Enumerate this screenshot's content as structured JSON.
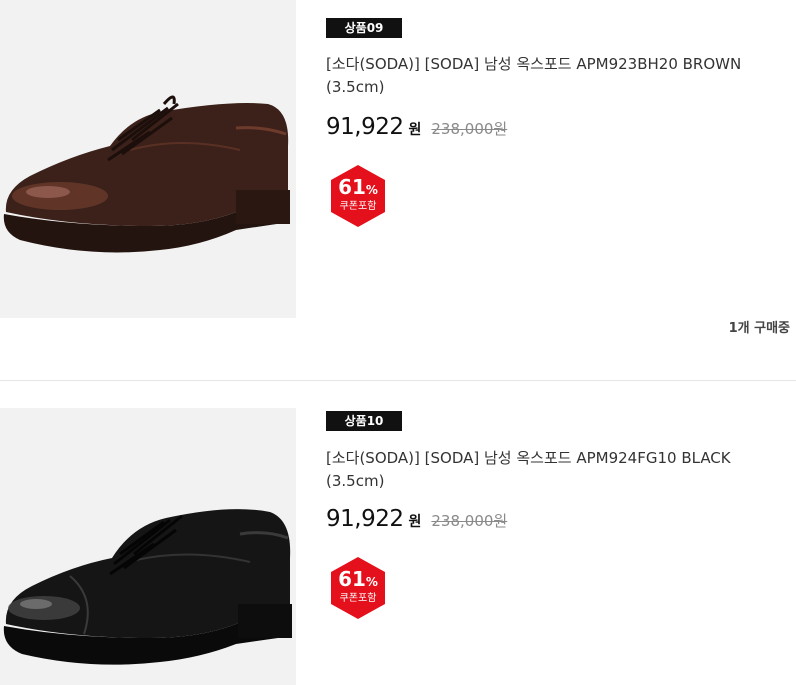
{
  "products": [
    {
      "badge": "상품09",
      "title": "[소다(SODA)] [SODA] 남성 옥스포드 APM923BH20 BROWN (3.5cm)",
      "price": "91,922",
      "price_unit": "원",
      "original_price": "238,000원",
      "discount_percent": "61",
      "discount_symbol": "%",
      "discount_note": "쿠폰포함",
      "purchase_count": "1개 구매중",
      "shoe_color": "#3b2119"
    },
    {
      "badge": "상품10",
      "title": "[소다(SODA)] [SODA] 남성 옥스포드 APM924FG10 BLACK (3.5cm)",
      "price": "91,922",
      "price_unit": "원",
      "original_price": "238,000원",
      "discount_percent": "61",
      "discount_symbol": "%",
      "discount_note": "쿠폰포함",
      "shoe_color": "#151515"
    }
  ],
  "colors": {
    "badge_bg": "#111111",
    "discount_red": "#e4101b",
    "thumb_bg": "#f2f2f2"
  },
  "icons": {
    "discount_shape": "hexagon-badge"
  }
}
